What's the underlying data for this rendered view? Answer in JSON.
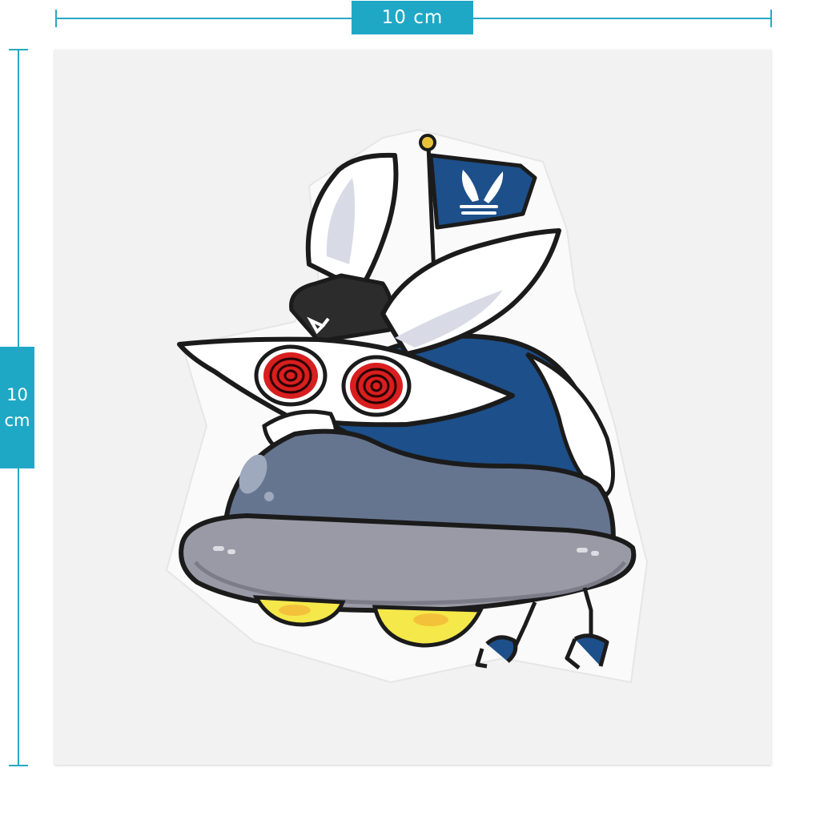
{
  "dimensions": {
    "width_label": "10 cm",
    "height_label": {
      "value": "10",
      "unit": "cm"
    }
  },
  "colors": {
    "accent": "#1fa8c6",
    "flag_blue": "#1d4f8a",
    "dome": "#66758f",
    "saucer": "#9a9aa6",
    "eyes": "#d81e1e",
    "lights": "#f5e84a"
  },
  "artwork": {
    "icon": "rabbit-ufo-sticker"
  }
}
